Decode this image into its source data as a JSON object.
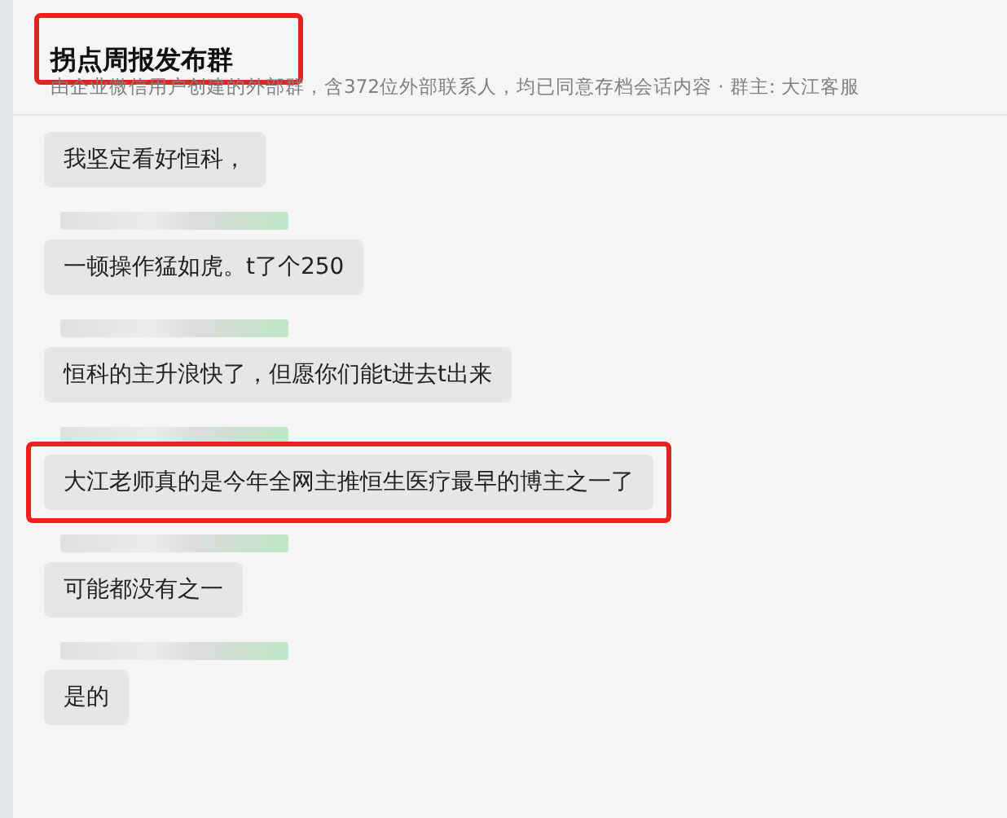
{
  "header": {
    "title": "拐点周报发布群",
    "subtitle": "由企业微信用户创建的外部群，含372位外部联系人，均已同意存档会话内容  · 群主: 大江客服",
    "highlighted": true
  },
  "messages": [
    {
      "text": "我坚定看好恒科，",
      "sender_redacted": false,
      "highlighted": false
    },
    {
      "text": "一顿操作猛如虎。t了个250",
      "sender_redacted": true,
      "highlighted": false
    },
    {
      "text": "恒科的主升浪快了，但愿你们能t进去t出来",
      "sender_redacted": true,
      "highlighted": false
    },
    {
      "text": "大江老师真的是今年全网主推恒生医疗最早的博主之一了",
      "sender_redacted": true,
      "highlighted": true
    },
    {
      "text": "可能都没有之一",
      "sender_redacted": true,
      "highlighted": false
    },
    {
      "text": "是的",
      "sender_redacted": true,
      "highlighted": false
    }
  ]
}
